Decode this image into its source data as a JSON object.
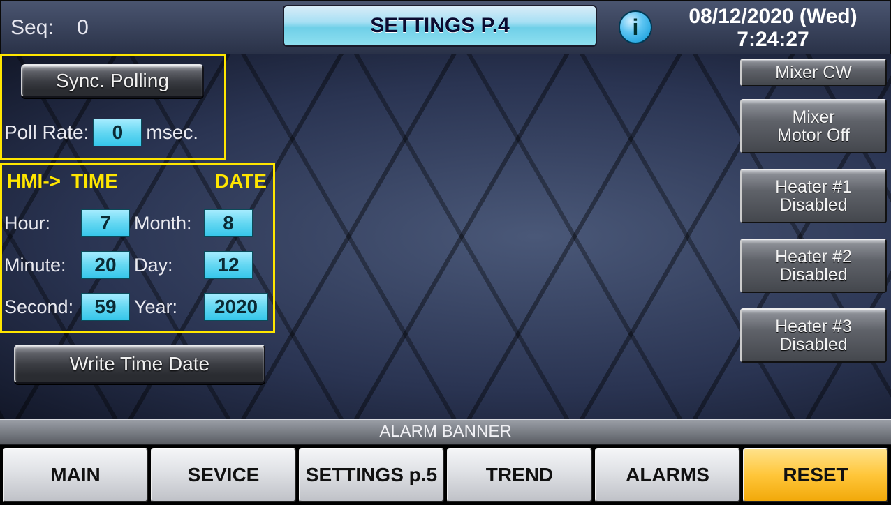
{
  "header": {
    "seq_label": "Seq:",
    "seq_value": "0",
    "title": "SETTINGS P.4",
    "info_glyph": "i",
    "date": "08/12/2020 (Wed)",
    "time": "7:24:27"
  },
  "poll_panel": {
    "sync_button": "Sync. Polling",
    "rate_label": "Poll Rate:",
    "rate_value": "0",
    "rate_unit": "msec."
  },
  "time_panel": {
    "hdr_hmi": "HMI->",
    "hdr_time": "TIME",
    "hdr_date": "DATE",
    "hour_label": "Hour:",
    "hour_value": "7",
    "minute_label": "Minute:",
    "minute_value": "20",
    "second_label": "Second:",
    "second_value": "59",
    "month_label": "Month:",
    "month_value": "8",
    "day_label": "Day:",
    "day_value": "12",
    "year_label": "Year:",
    "year_value": "2020",
    "write_button": "Write Time  Date"
  },
  "right_buttons": {
    "mixer_cw": "Mixer CW",
    "mixer_motor_l1": "Mixer",
    "mixer_motor_l2": "Motor Off",
    "heater1_l1": "Heater #1",
    "heater1_l2": "Disabled",
    "heater2_l1": "Heater #2",
    "heater2_l2": "Disabled",
    "heater3_l1": "Heater #3",
    "heater3_l2": "Disabled"
  },
  "alarm_banner": "ALARM BANNER",
  "nav": {
    "main": "MAIN",
    "service": "SEVICE",
    "settings": "SETTINGS p.5",
    "trend": "TREND",
    "alarms": "ALARMS",
    "reset": "RESET"
  }
}
